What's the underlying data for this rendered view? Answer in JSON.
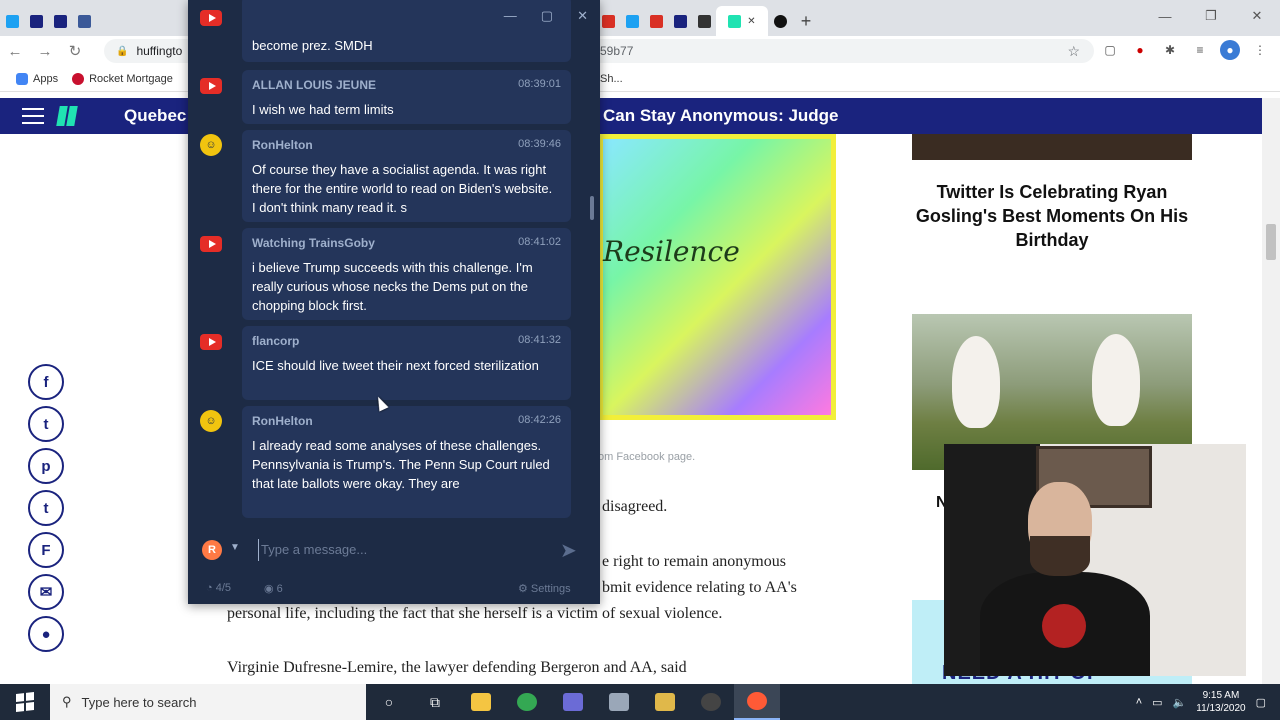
{
  "browser": {
    "url": "huffingto",
    "url_tail": "59b77",
    "bookmarks": [
      {
        "label": "Apps"
      },
      {
        "label": "Rocket Mortgage"
      }
    ],
    "bookmark_far": "Sh..."
  },
  "site": {
    "headline_left": "Quebec",
    "headline_right": "Can Stay Anonymous: Judge"
  },
  "article": {
    "hero_word": "Resilence",
    "caption": "om Facebook page.",
    "p1": "disagreed.",
    "p2_line1": "e right to remain anonymous",
    "p2_line2": "bmit evidence relating to AA's",
    "p2_line3": "personal life, including the fact that she herself is a victim of sexual violence.",
    "p3": "Virginie Dufresne-Lemire, the lawyer defending Bergeron and AA, said"
  },
  "share": {
    "items": [
      "f",
      "t",
      "p",
      "t",
      "F",
      "✉",
      "●"
    ]
  },
  "sidebar": {
    "story_title": "Twitter Is Celebrating Ryan Gosling's Best Moments On His Birthday",
    "mini_text": "N",
    "bottom_text": "NEED A HIT OF"
  },
  "chat": {
    "messages": [
      {
        "platform": "youtube",
        "author": "",
        "time": "",
        "text": "become prez. SMDH"
      },
      {
        "platform": "youtube",
        "author": "ALLAN LOUIS JEUNE",
        "time": "08:39:01",
        "text": "I wish we had term limits"
      },
      {
        "platform": "twitch",
        "author": "RonHelton",
        "time": "08:39:46",
        "text": "Of course they have a socialist agenda. It was right there for the entire world to read on Biden's website. I don't think many read it. s"
      },
      {
        "platform": "youtube",
        "author": "Watching TrainsGoby",
        "time": "08:41:02",
        "text": "i believe Trump succeeds with this challenge. I'm really curious whose necks the Dems put on the chopping block first."
      },
      {
        "platform": "youtube",
        "author": "flancorp",
        "time": "08:41:32",
        "text": "ICE should live tweet their next forced sterilization"
      },
      {
        "platform": "twitch",
        "author": "RonHelton",
        "time": "08:42:26",
        "text": "I already read some analyses of these challenges. Pennsylvania is Trump's. The Penn Sup Court ruled that late ballots were okay. They are"
      }
    ],
    "input_placeholder": "Type a message...",
    "avatar_letter": "R",
    "footer_count": "4/5",
    "footer_views": "6",
    "footer_settings": "Settings"
  },
  "taskbar": {
    "search_placeholder": "Type here to search",
    "time": "9:15 AM",
    "date": "11/13/2020"
  },
  "colors": {
    "site_header": "#1a237e",
    "chat_bg": "#1d2b45",
    "chat_bubble": "#24355a",
    "youtube_red": "#e52d27"
  }
}
